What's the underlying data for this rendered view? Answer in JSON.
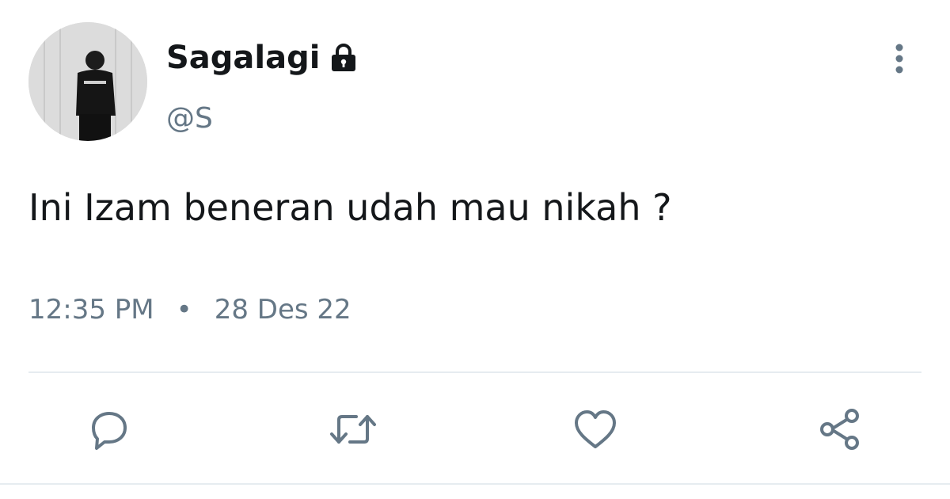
{
  "tweet": {
    "display_name": "Sagalagi",
    "handle": "@S",
    "text": "Ini Izam beneran udah mau nikah ?",
    "time": "12:35 PM",
    "separator": "•",
    "date": "28 Des 22",
    "protected": true
  },
  "icons": {
    "lock": "lock-icon",
    "more": "more-vertical-icon",
    "reply": "reply-icon",
    "retweet": "retweet-icon",
    "like": "heart-icon",
    "share": "share-icon"
  },
  "colors": {
    "name": "#14171a",
    "secondary": "#657786",
    "icon": "#657786",
    "divider": "#e6ecf0"
  }
}
